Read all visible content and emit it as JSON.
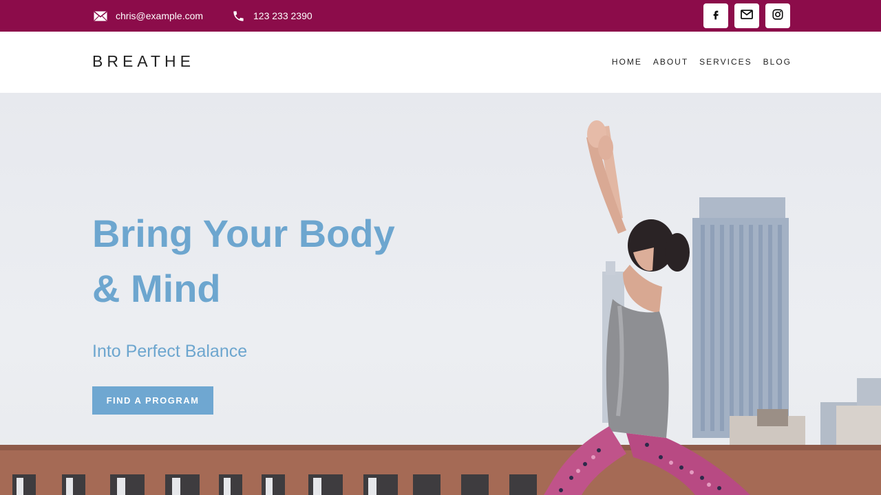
{
  "topbar": {
    "email": "chris@example.com",
    "phone": "123 233 2390",
    "background": "#8c0c4a",
    "social_icons": [
      "facebook-icon",
      "mail-icon",
      "instagram-icon"
    ]
  },
  "header": {
    "logo": "BREATHE",
    "nav": [
      "HOME",
      "ABOUT",
      "SERVICES",
      "BLOG"
    ]
  },
  "hero": {
    "title_line1": "Bring Your Body",
    "title_line2": "& Mind",
    "subtitle": "Into Perfect Balance",
    "cta_label": "FIND A PROGRAM",
    "accent": "#6da6cf"
  }
}
